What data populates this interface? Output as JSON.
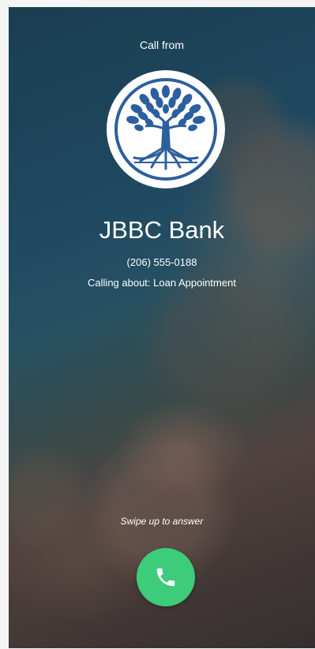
{
  "incoming_call": {
    "header": "Call from",
    "caller_name": "JBBC Bank",
    "phone_number": "(206) 555-0188",
    "reason": "Calling about: Loan Appointment",
    "swipe_hint": "Swipe up to answer",
    "logo_icon": "tree-of-life-logo",
    "answer_icon": "phone-icon"
  },
  "colors": {
    "answer_button": "#3dcc7a",
    "logo_blue": "#2c5f9e",
    "text": "#ffffff"
  }
}
